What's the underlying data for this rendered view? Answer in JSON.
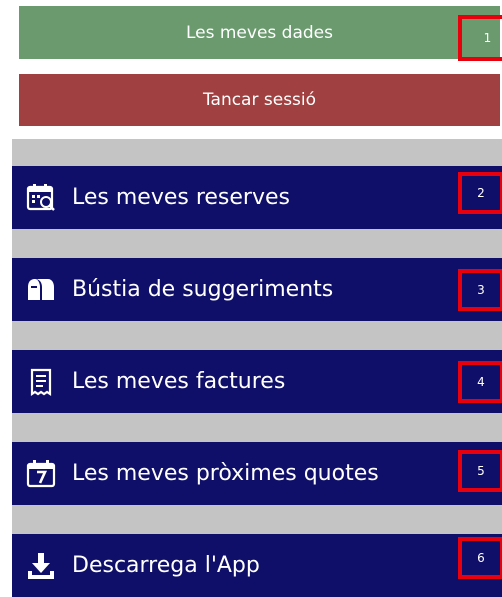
{
  "colors": {
    "data_button": "#6a9a6d",
    "logout_button": "#a04040",
    "menu_background": "#0f0f69",
    "separator_gray": "#c4c4c4",
    "marker_red": "#e8000d"
  },
  "header": {
    "data_button_label": "Les meves dades",
    "data_button_marker": "1",
    "logout_button_label": "Tancar sessió"
  },
  "menu": {
    "items": [
      {
        "label": "Les meves reserves",
        "icon": "calendar-search-icon",
        "marker": "2"
      },
      {
        "label": "Bústia de suggeriments",
        "icon": "mailbox-icon",
        "marker": "3"
      },
      {
        "label": "Les meves factures",
        "icon": "receipt-icon",
        "marker": "4"
      },
      {
        "label": "Les meves pròximes quotes",
        "icon": "calendar-7-icon",
        "marker": "5"
      },
      {
        "label": "Descarrega l'App",
        "icon": "download-icon",
        "marker": "6"
      }
    ]
  }
}
